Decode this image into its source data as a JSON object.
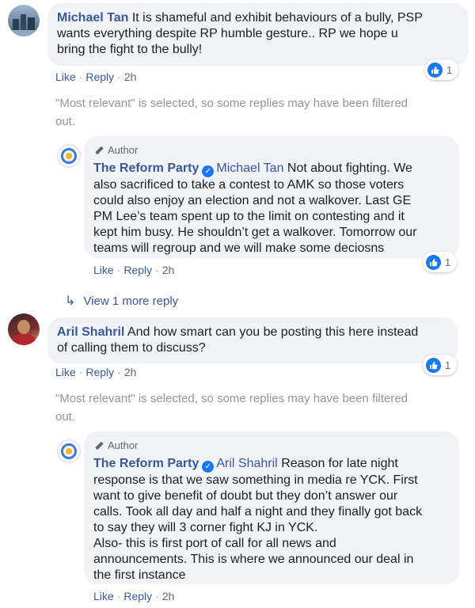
{
  "comments": [
    {
      "author": "Michael Tan",
      "text_line1": "It is shameful and exhibit behaviours of a bully, PSP",
      "text_line2": "wants everything despite RP humble gesture.. RP we hope u",
      "text_line3": "bring the fight to the bully!",
      "like_label": "Like",
      "reply_label": "Reply",
      "time": "2h",
      "reaction_count": "1",
      "reaction_icon": "thumbs-up-icon"
    },
    {
      "author": "Aril Shahril",
      "text_line1": "And how smart can you be posting this here instead",
      "text_line2": "of calling them to discuss?",
      "like_label": "Like",
      "reply_label": "Reply",
      "time": "2h",
      "reaction_count": "1",
      "reaction_icon": "thumbs-up-icon"
    }
  ],
  "filter_notice_line1": "\"Most relevant\" is selected, so some replies may have been filtered",
  "filter_notice_line2": "out.",
  "replies": [
    {
      "badge": "Author",
      "author": "The Reform Party",
      "mention": "Michael Tan",
      "line1": "Not about fighting. We",
      "line2": "also sacrificed to take a contest to AMK so those voters",
      "line3": "could also enjoy an election and not a walkover. Last GE",
      "line4": "PM Lee’s team spent up to the limit on contesting and it",
      "line5": "kept him busy. He shouldn’t get a walkover. Tomorrow our",
      "line6": "teams will regroup and we will make some deciosns",
      "like_label": "Like",
      "reply_label": "Reply",
      "time": "2h",
      "reaction_count": "1"
    },
    {
      "badge": "Author",
      "author": "The Reform Party",
      "mention": "Aril Shahril",
      "line1": "Reason for late night",
      "line2": "response is that we saw something in media re YCK. First",
      "line3": "want to give benefit of doubt but they don’t answer our",
      "line4": "calls. Took all day and half a night and they finally got back",
      "line5": "to say they will 3 corner fight KJ in YCK.",
      "line6": "Also- this is first port of call for all news and",
      "line7": "announcements. This is where we announced our deal in",
      "line8": "the first instance",
      "like_label": "Like",
      "reply_label": "Reply",
      "time": "2h"
    }
  ],
  "view_more": "View 1 more reply",
  "colors": {
    "link": "#385898",
    "bubble": "#f0f2f5",
    "like_blue": "#1877f2",
    "muted": "#90949c"
  }
}
